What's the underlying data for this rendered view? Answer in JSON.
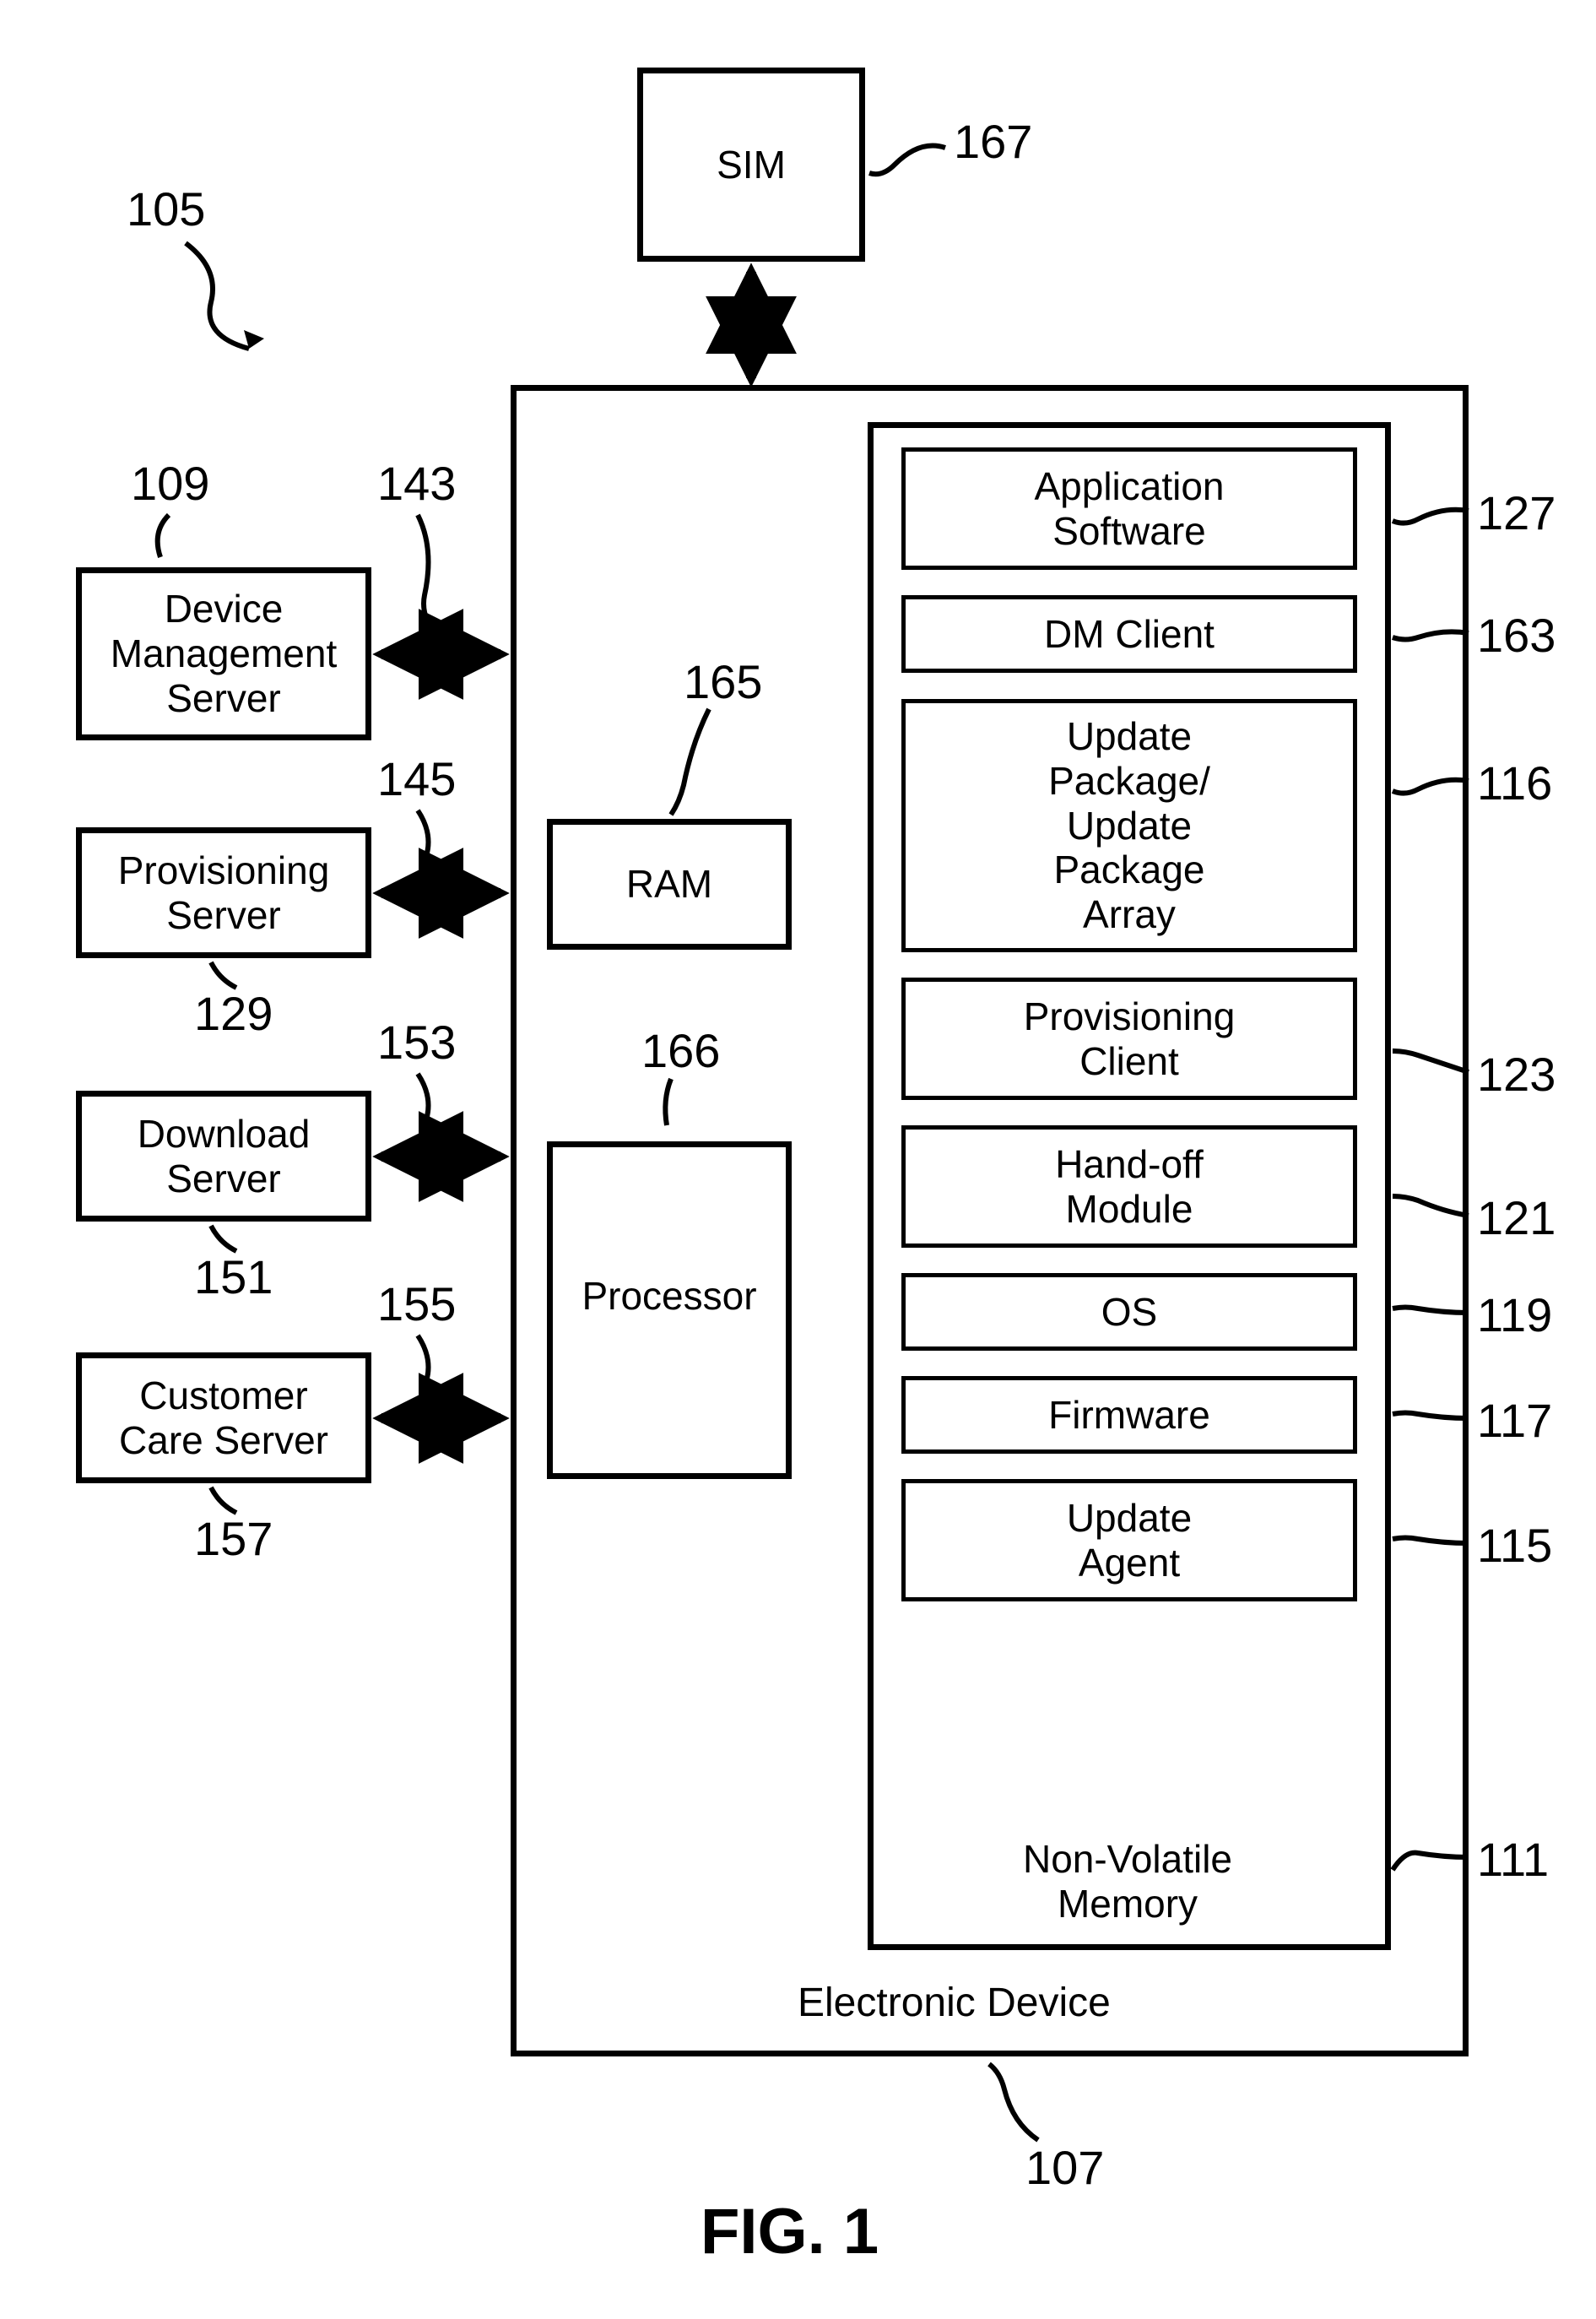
{
  "diagram": {
    "system_ref": "105",
    "fig_label": "FIG. 1",
    "sim": {
      "label": "SIM",
      "ref": "167"
    },
    "device": {
      "label": "Electronic Device",
      "ref": "107"
    },
    "ram": {
      "label": "RAM",
      "ref": "165"
    },
    "processor": {
      "label": "Processor",
      "ref": "166"
    },
    "nvmem": {
      "label": "Non-Volatile\nMemory",
      "ref": "111"
    },
    "nv_items": {
      "app": {
        "label": "Application\nSoftware",
        "ref": "127"
      },
      "dm": {
        "label": "DM Client",
        "ref": "163"
      },
      "upkg": {
        "label": "Update\nPackage/\nUpdate\nPackage\nArray",
        "ref": "116"
      },
      "prov": {
        "label": "Provisioning\nClient",
        "ref": "123"
      },
      "hand": {
        "label": "Hand-off\nModule",
        "ref": "121"
      },
      "os": {
        "label": "OS",
        "ref": "119"
      },
      "fw": {
        "label": "Firmware",
        "ref": "117"
      },
      "ua": {
        "label": "Update\nAgent",
        "ref": "115"
      }
    },
    "servers": {
      "dms": {
        "label": "Device\nManagement\nServer",
        "ref": "109",
        "link_ref": "143"
      },
      "prov": {
        "label": "Provisioning\nServer",
        "ref": "129",
        "link_ref": "145"
      },
      "dl": {
        "label": "Download\nServer",
        "ref": "151",
        "link_ref": "153"
      },
      "cc": {
        "label": "Customer\nCare Server",
        "ref": "157",
        "link_ref": "155"
      }
    }
  }
}
